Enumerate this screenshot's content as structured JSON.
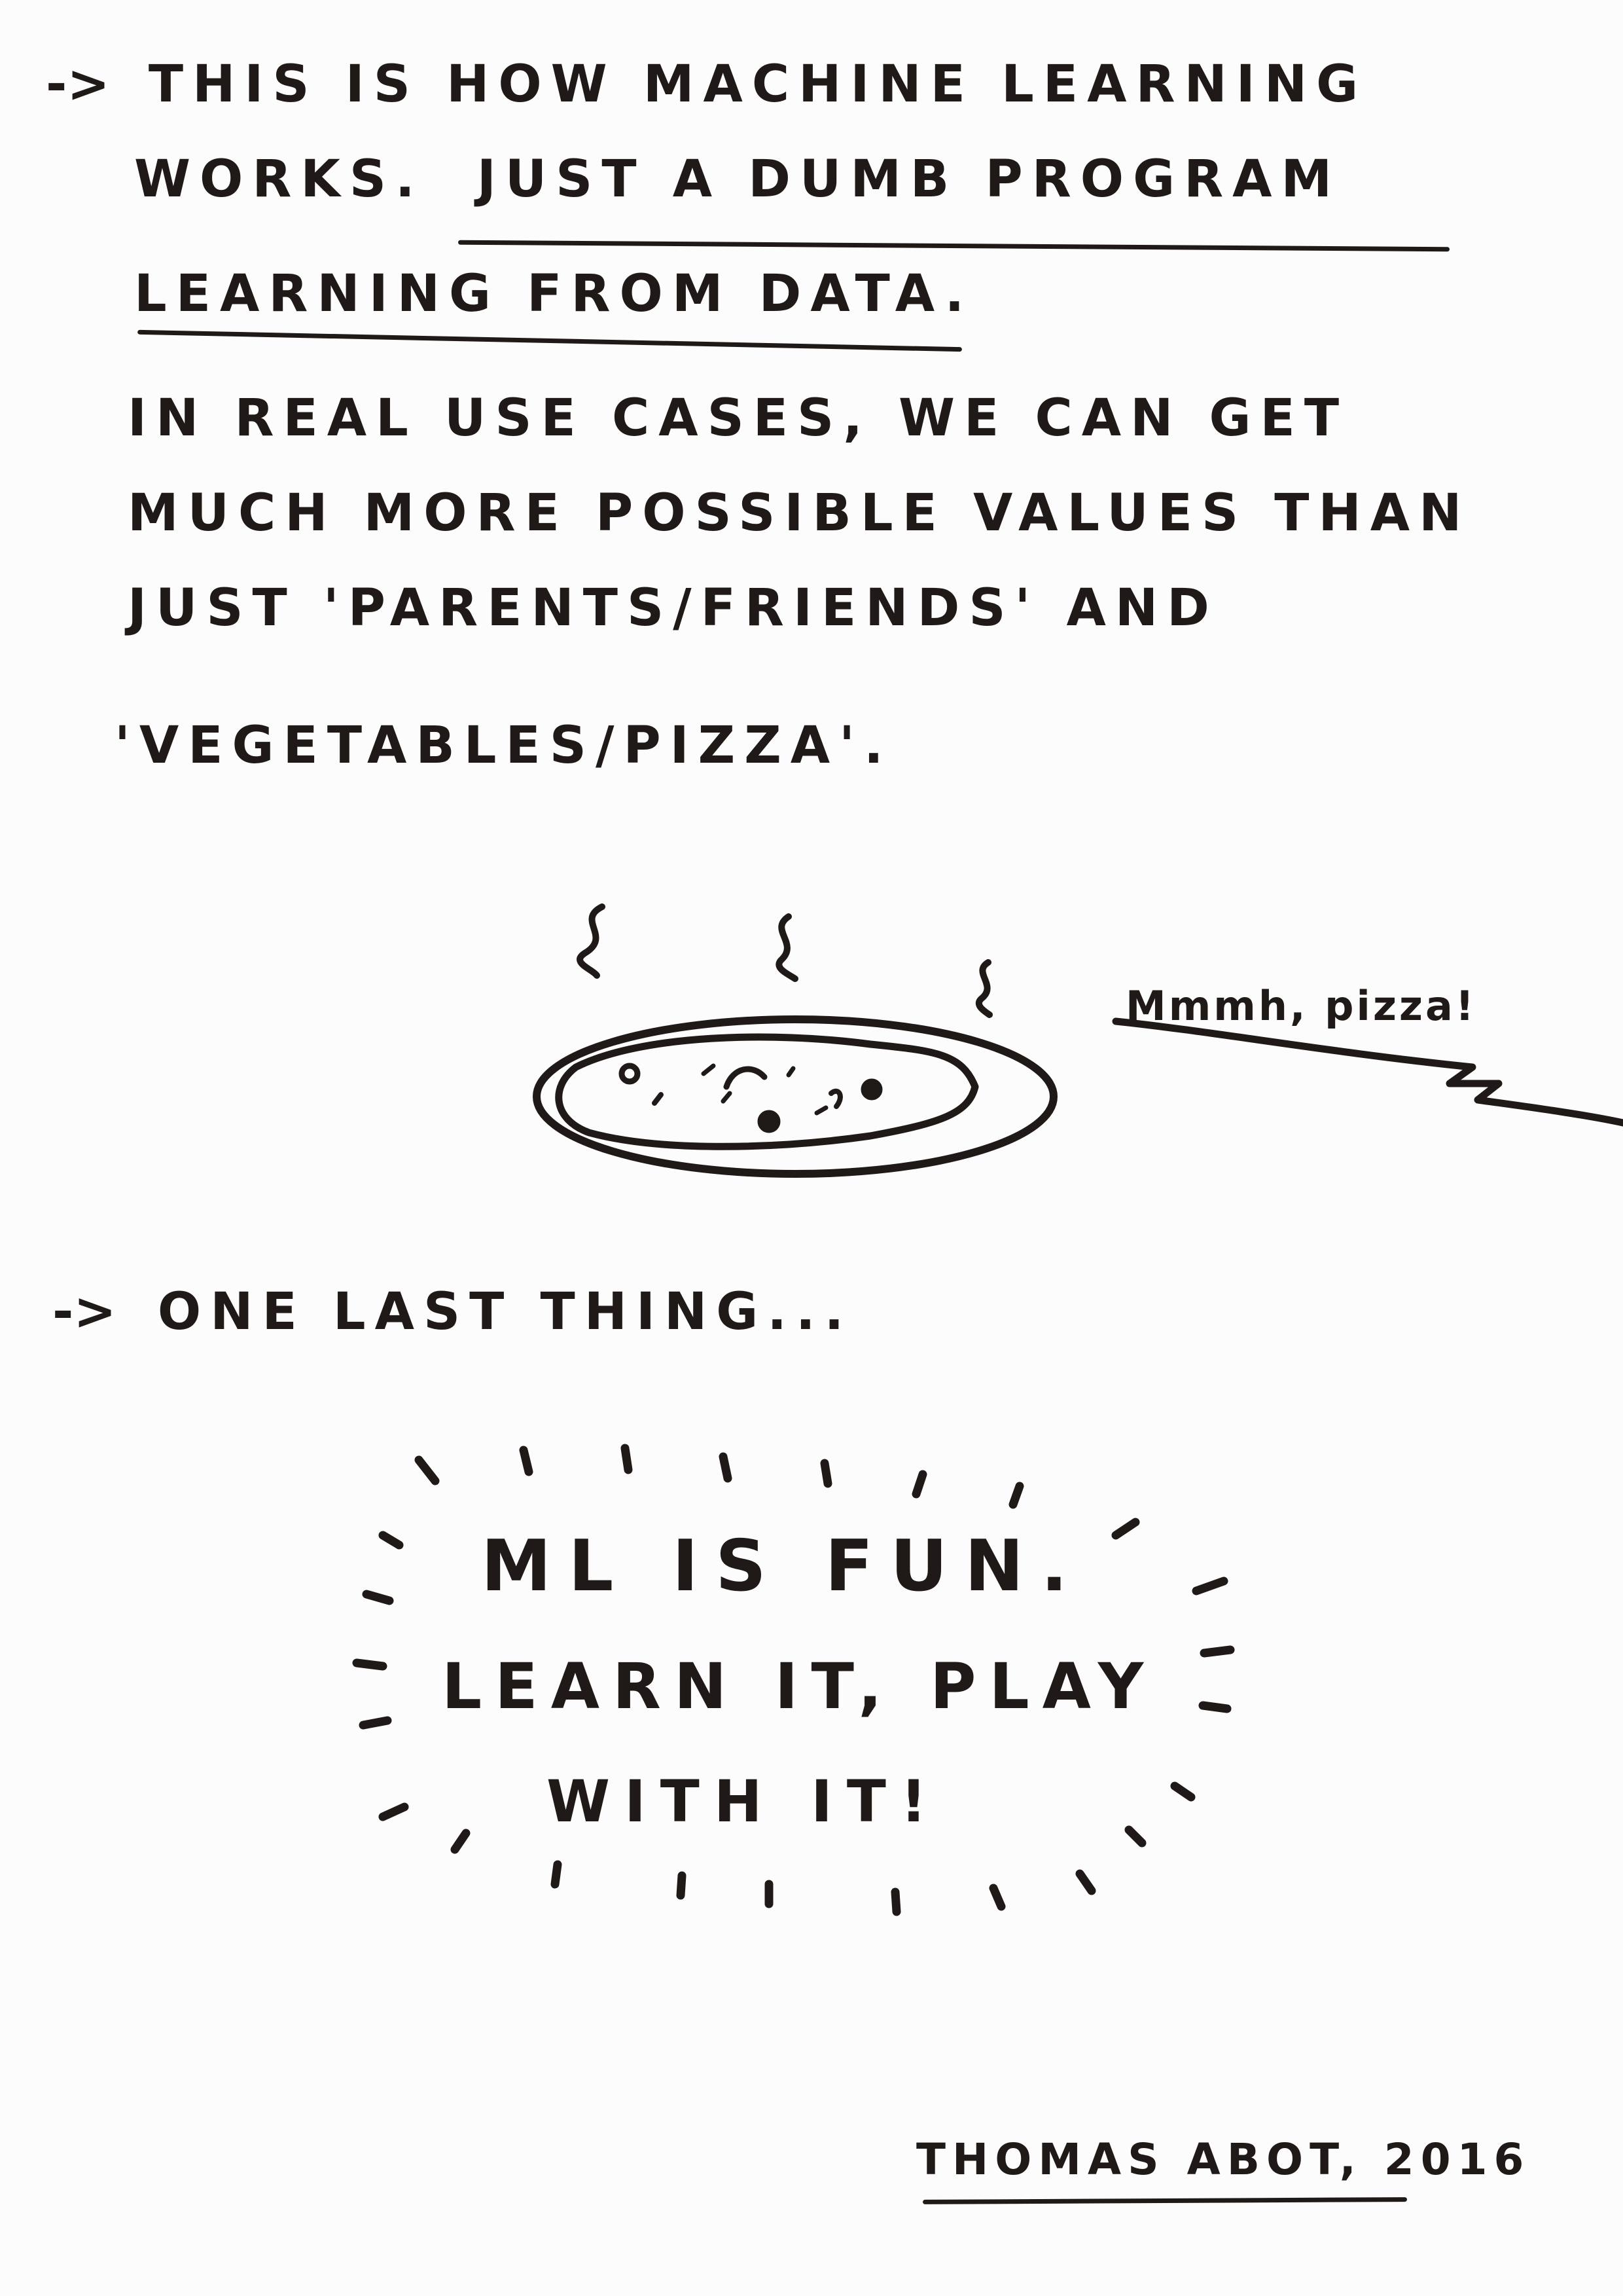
{
  "intro": {
    "arrow": "->",
    "line1": "THIS IS HOW MACHINE LEARNING",
    "line2_start": "WORKS.",
    "line2_underlined": "JUST A DUMB PROGRAM",
    "line3_underlined": "LEARNING FROM DATA",
    "line3_end": "."
  },
  "real_cases": {
    "line1": "IN REAL USE CASES, WE CAN GET",
    "line2": "MUCH MORE POSSIBLE VALUES THAN",
    "line3": "JUST 'PARENTS/FRIENDS' AND",
    "line4": "'VEGETABLES/PIZZA'."
  },
  "pizza": {
    "speech": "Mmmh, pizza!",
    "icon": "pizza-icon"
  },
  "last_thing": {
    "arrow": "->",
    "text": "ONE LAST THING..."
  },
  "fun_message": {
    "line1": "ML IS FUN.",
    "line2": "LEARN IT, PLAY",
    "line3": "WITH IT!"
  },
  "signature": {
    "name": "THOMAS ABOT",
    "year": ", 2016"
  },
  "colors": {
    "ink": "#1f1a17",
    "paper": "#fcfcfc"
  }
}
